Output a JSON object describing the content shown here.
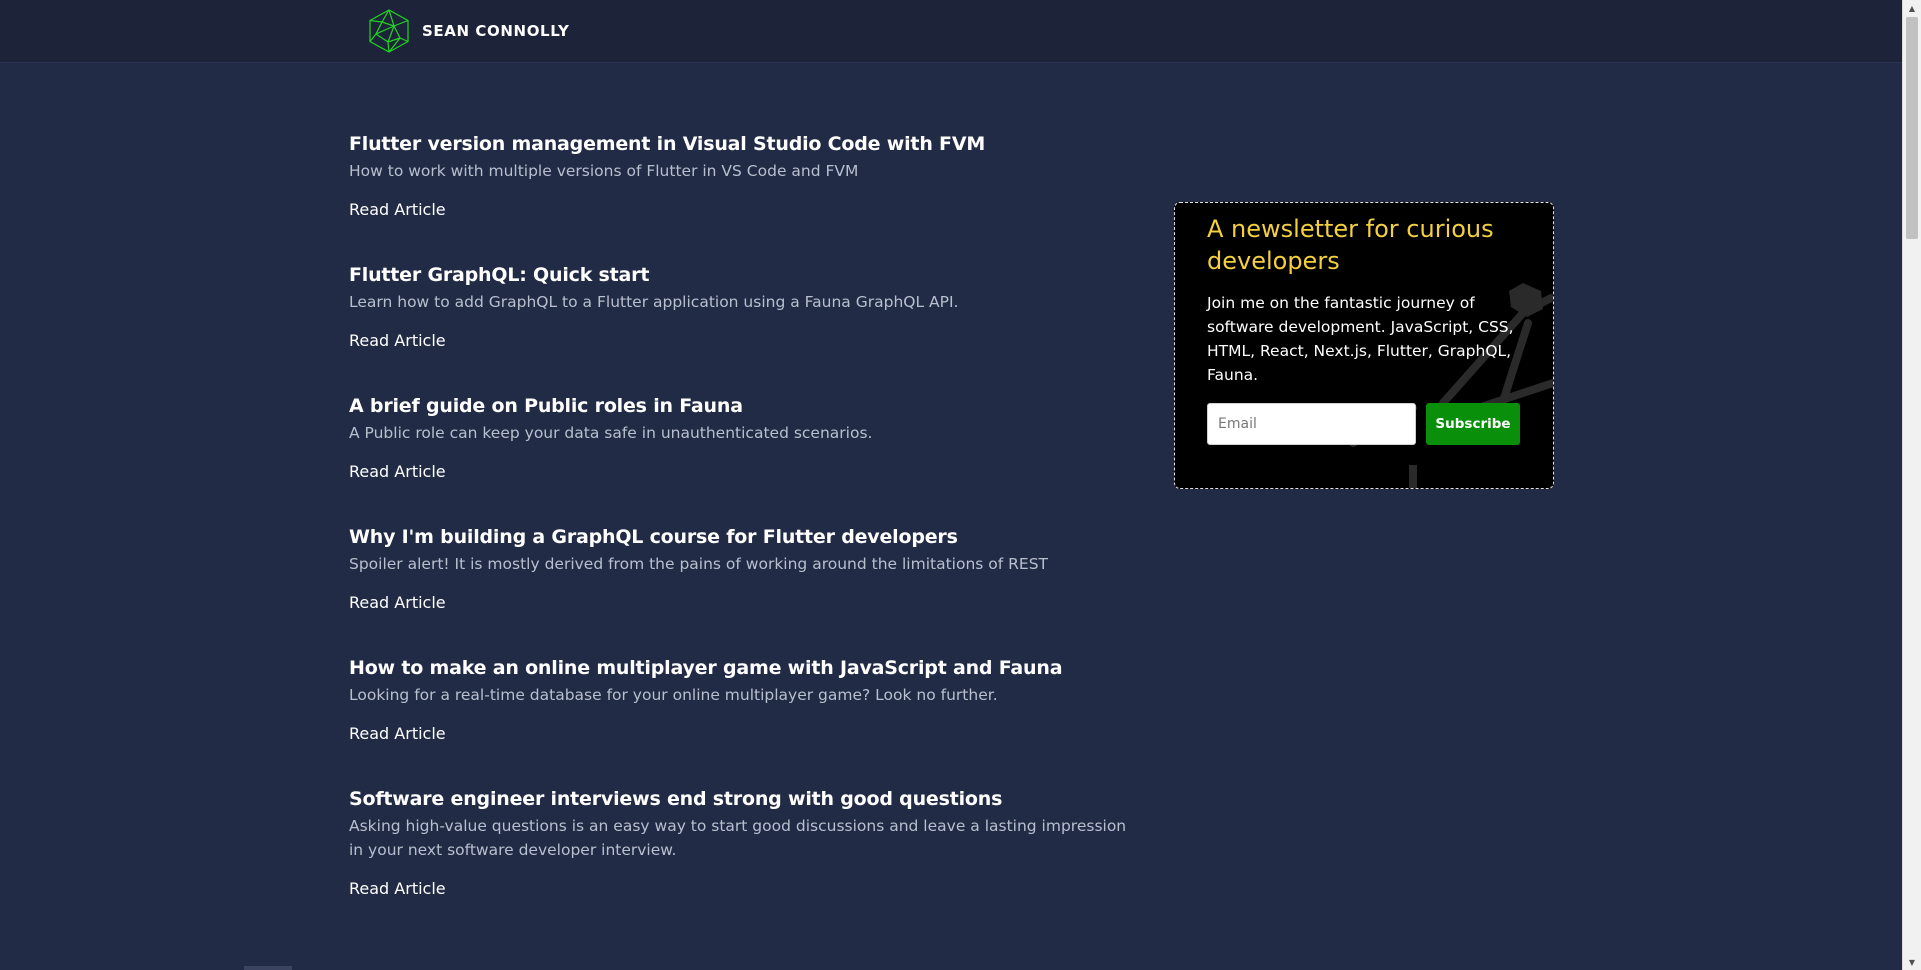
{
  "header": {
    "brand_name": "SEAN CONNOLLY",
    "logo_icon": "hexagon-network-logo",
    "accent_color": "#1fd61f"
  },
  "articles": [
    {
      "title": "Flutter version management in Visual Studio Code with FVM",
      "description": "How to work with multiple versions of Flutter in VS Code and FVM",
      "link_label": "Read Article"
    },
    {
      "title": "Flutter GraphQL: Quick start",
      "description": "Learn how to add GraphQL to a Flutter application using a Fauna GraphQL API.",
      "link_label": "Read Article"
    },
    {
      "title": "A brief guide on Public roles in Fauna",
      "description": "A Public role can keep your data safe in unauthenticated scenarios.",
      "link_label": "Read Article"
    },
    {
      "title": "Why I'm building a GraphQL course for Flutter developers",
      "description": "Spoiler alert! It is mostly derived from the pains of working around the limitations of REST",
      "link_label": "Read Article"
    },
    {
      "title": "How to make an online multiplayer game with JavaScript and Fauna",
      "description": "Looking for a real-time database for your online multiplayer game? Look no further.",
      "link_label": "Read Article"
    },
    {
      "title": "Software engineer interviews end strong with good questions",
      "description": "Asking high-value questions is an easy way to start good discussions and leave a lasting impression in your next software developer interview.",
      "link_label": "Read Article"
    }
  ],
  "newsletter": {
    "title": "A newsletter for curious developers",
    "text": "Join me on the fantastic journey of software development. JavaScript, CSS, HTML, React, Next.js, Flutter, GraphQL, Fauna.",
    "email_placeholder": "Email",
    "subscribe_label": "Subscribe",
    "title_color": "#f4d03f",
    "button_color": "#0a8f0a"
  },
  "colors": {
    "page_background": "#222b45",
    "header_background": "#1d243a"
  }
}
